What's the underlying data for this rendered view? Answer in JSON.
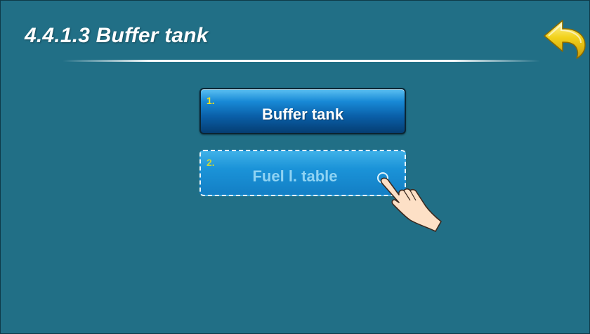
{
  "header": {
    "title": "4.4.1.3 Buffer tank",
    "back_icon": "back-arrow-icon"
  },
  "menu": {
    "items": [
      {
        "number": "1.",
        "label": "Buffer tank",
        "state": "normal"
      },
      {
        "number": "2.",
        "label": "Fuel l. table",
        "state": "pressed"
      }
    ]
  },
  "cursor": {
    "icon": "hand-pointer-icon"
  },
  "colors": {
    "background": "#216f86",
    "button_normal": "#0a5fa8",
    "button_pressed": "#1b93d8",
    "number_accent": "#f6e21a",
    "back_arrow": "#f2d21c"
  }
}
